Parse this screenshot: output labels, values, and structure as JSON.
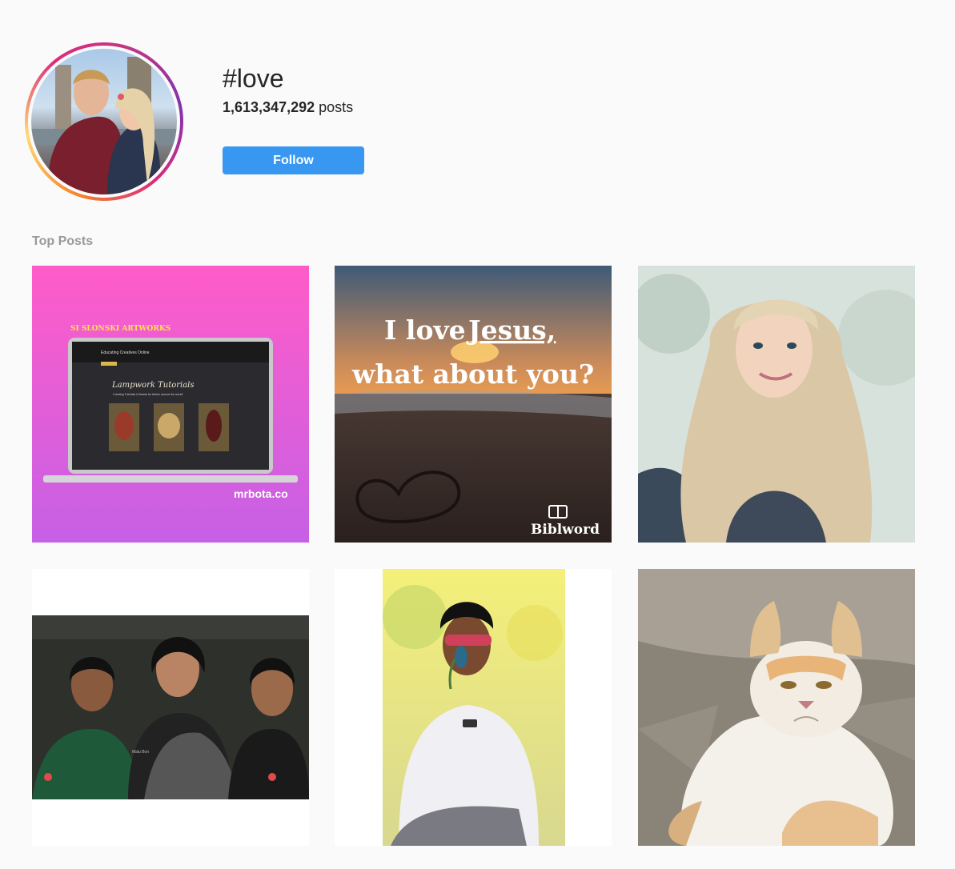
{
  "header": {
    "hashtag": "#love",
    "post_count": "1,613,347,292",
    "post_count_suffix": " posts",
    "follow_label": "Follow"
  },
  "section": {
    "title": "Top Posts"
  },
  "posts": [
    {
      "kind": "website-mockup",
      "top_text": "SI SLONSKI ARTWORKS",
      "screen_heading": "Educating Creatives Online",
      "screen_subtitle": "Lampwork Tutorials",
      "screen_caption": "Creating Tutorials & Beads for Artists around the world!",
      "watermark": "mrbota.co"
    },
    {
      "kind": "quote-beach",
      "line1_a": "I love ",
      "line1_b": "Jesus,",
      "line2": "what about you?",
      "brand": "Biblword"
    },
    {
      "kind": "portrait-woman"
    },
    {
      "kind": "group-photo",
      "shirt_text": "Malu Bon"
    },
    {
      "kind": "man-portrait"
    },
    {
      "kind": "cat-photo"
    }
  ],
  "colors": {
    "accent": "#3897f0",
    "muted": "#999999",
    "background": "#fafafa"
  }
}
